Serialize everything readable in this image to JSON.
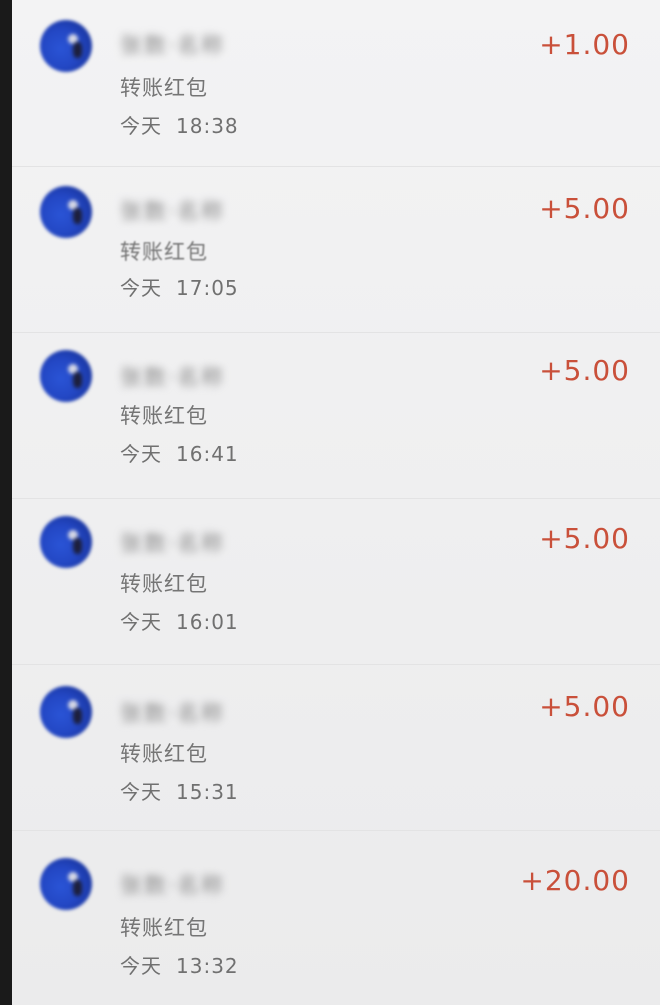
{
  "colors": {
    "amount": "#c9503a",
    "avatar": "#2347c4",
    "text_secondary": "#757575"
  },
  "transactions": [
    {
      "name": "张数·名称",
      "type": "转账红包",
      "day": "今天",
      "time": "18:38",
      "amount": "+1.00"
    },
    {
      "name": "张数·名称",
      "type": "转账红包",
      "day": "今天",
      "time": "17:05",
      "amount": "+5.00"
    },
    {
      "name": "张数·名称",
      "type": "转账红包",
      "day": "今天",
      "time": "16:41",
      "amount": "+5.00"
    },
    {
      "name": "张数·名称",
      "type": "转账红包",
      "day": "今天",
      "time": "16:01",
      "amount": "+5.00"
    },
    {
      "name": "张数·名称",
      "type": "转账红包",
      "day": "今天",
      "time": "15:31",
      "amount": "+5.00"
    },
    {
      "name": "张数·名称",
      "type": "转账红包",
      "day": "今天",
      "time": "13:32",
      "amount": "+20.00"
    }
  ]
}
